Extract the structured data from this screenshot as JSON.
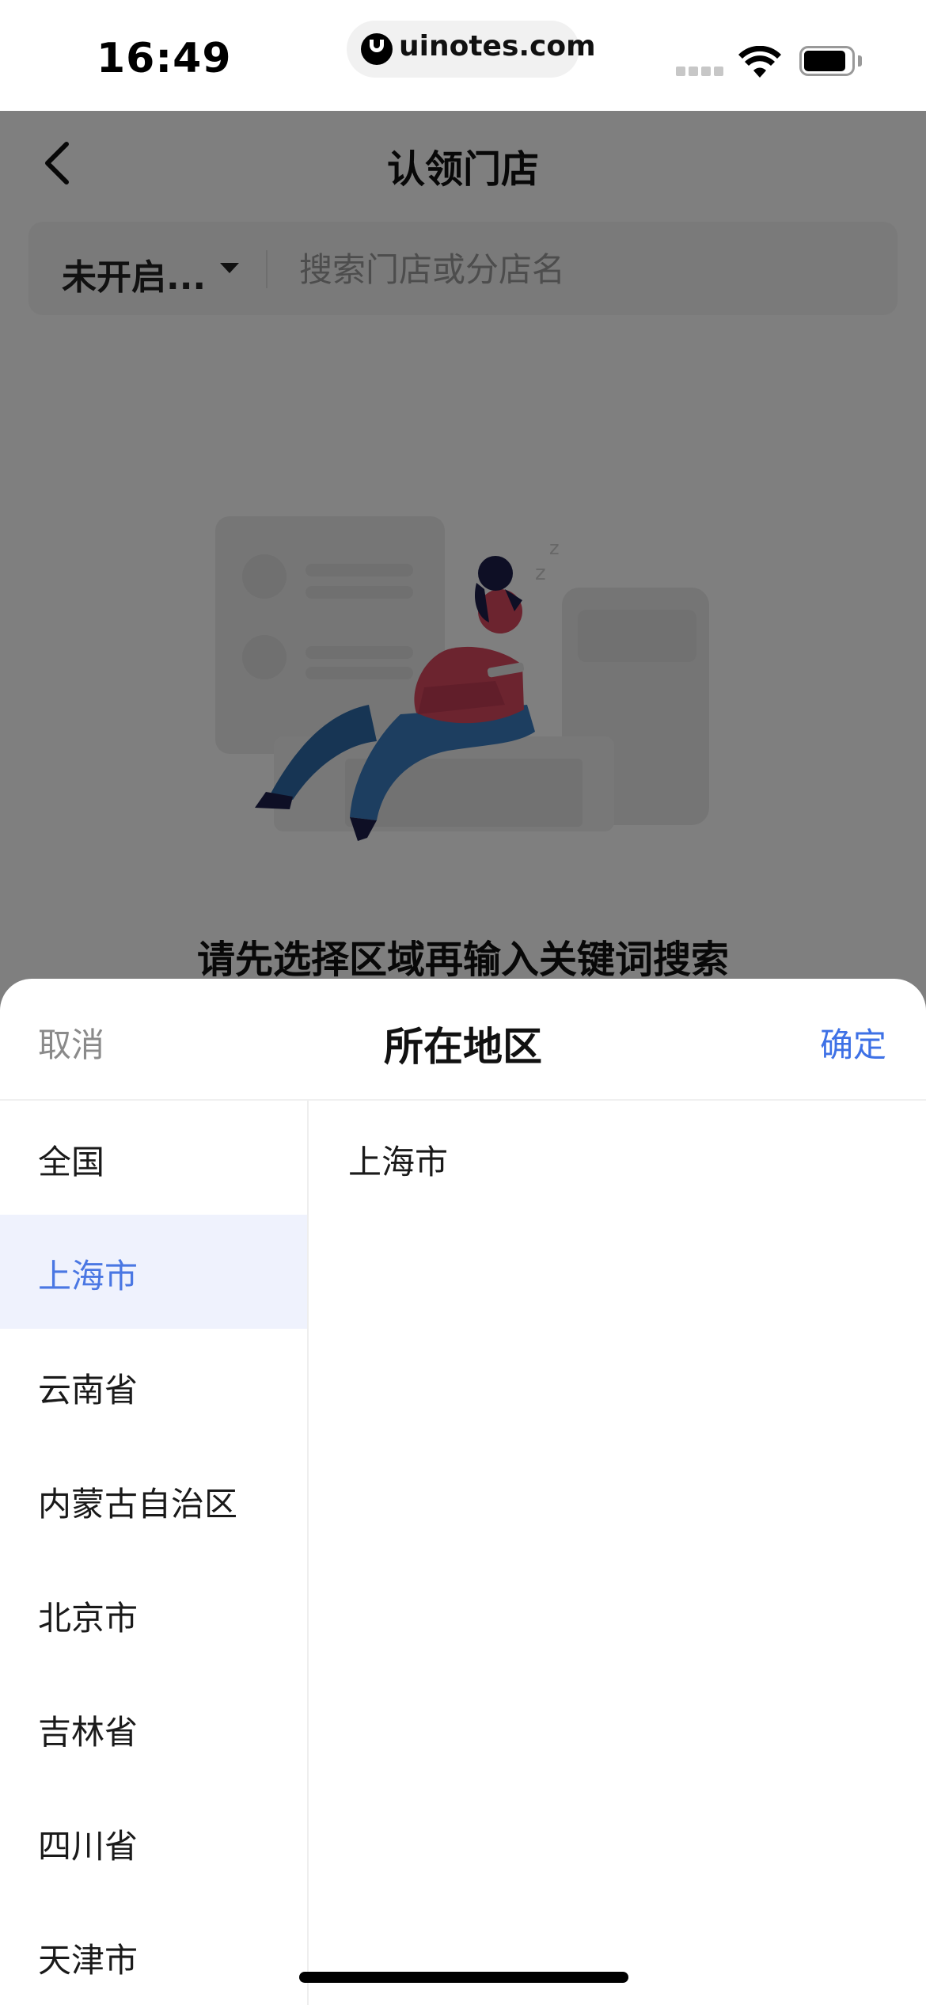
{
  "status_bar": {
    "time": "16:49",
    "url": "uinotes.com",
    "logo_icon": "uinotes-logo-icon",
    "signal_icon": "cellular-signal-icon",
    "wifi_icon": "wifi-icon",
    "battery_icon": "battery-icon"
  },
  "header": {
    "back_icon": "chevron-left-icon",
    "title": "认领门店"
  },
  "search": {
    "filter_label": "未开启...",
    "filter_icon": "caret-down-icon",
    "placeholder": "搜索门店或分店名",
    "value": ""
  },
  "empty_state": {
    "illustration": "person-sleeping-illustration",
    "message": "请先选择区域再输入关键词搜索"
  },
  "region_sheet": {
    "cancel_label": "取消",
    "title": "所在地区",
    "confirm_label": "确定",
    "confirm_color": "#3e71e6",
    "selected_highlight_color": "#eff2fd",
    "provinces": [
      "全国",
      "上海市",
      "云南省",
      "内蒙古自治区",
      "北京市",
      "吉林省",
      "四川省",
      "天津市"
    ],
    "selected_province": "上海市",
    "cities": [
      "上海市"
    ]
  },
  "overlay": {
    "color": "#000000",
    "opacity": 0.5
  }
}
